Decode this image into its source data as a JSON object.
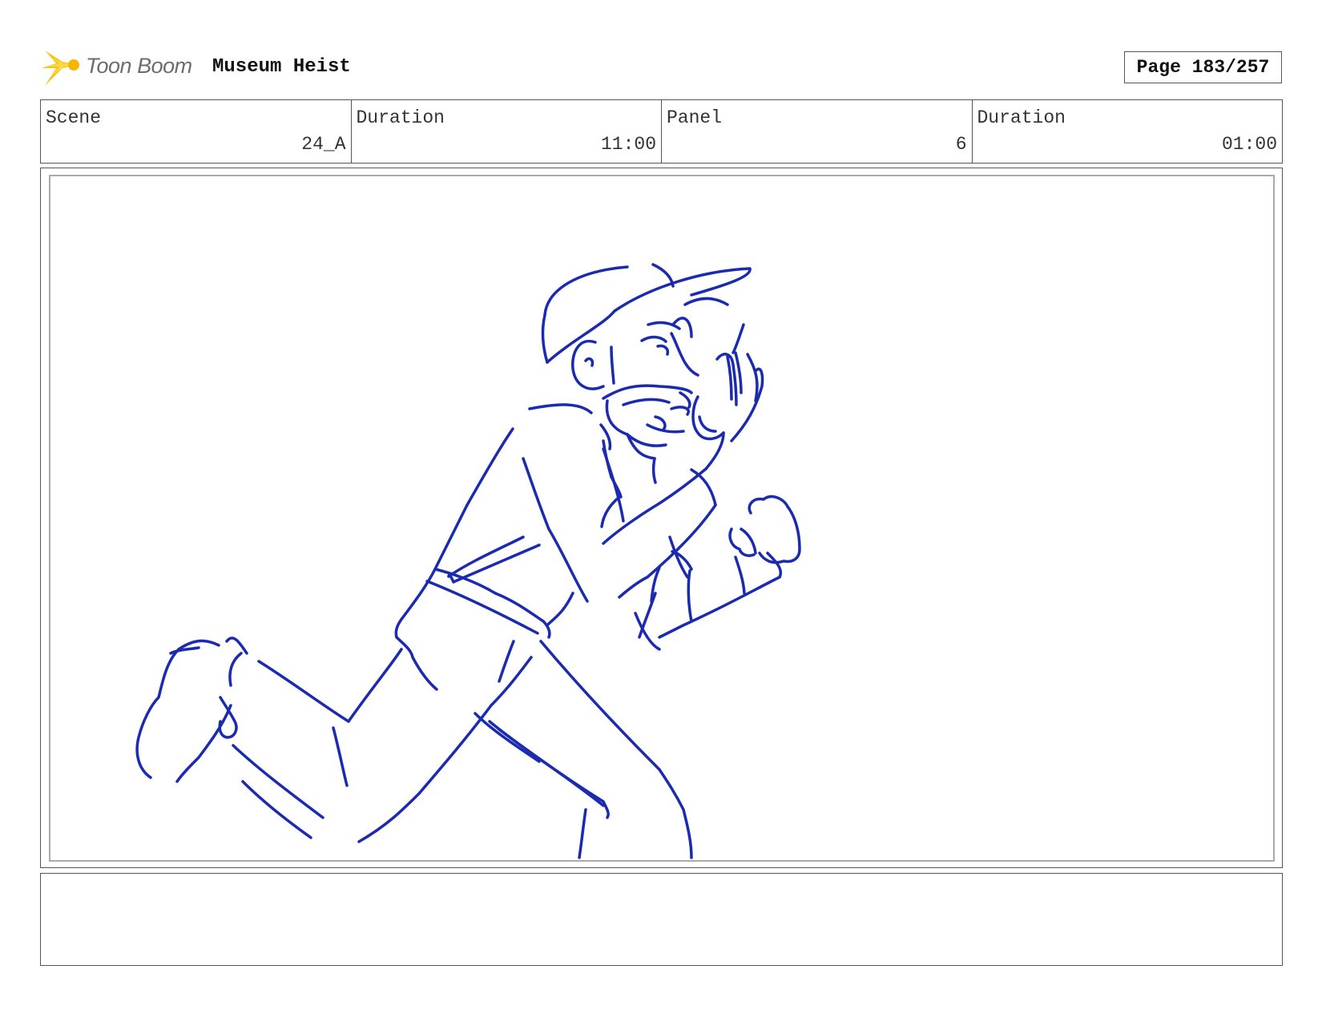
{
  "header": {
    "logo_text": "Toon Boom",
    "logo_icon": "sparkle-star-icon",
    "project_title": "Museum Heist",
    "page_label": "Page 183/257"
  },
  "info": {
    "scene_label": "Scene",
    "scene_value": "24_A",
    "scene_duration_label": "Duration",
    "scene_duration_value": "11:00",
    "panel_label": "Panel",
    "panel_value": "6",
    "panel_duration_label": "Duration",
    "panel_duration_value": "01:00"
  },
  "colors": {
    "sketch": "#1a2bb0",
    "logo_accent": "#f5c518"
  },
  "notes": {
    "text": ""
  }
}
